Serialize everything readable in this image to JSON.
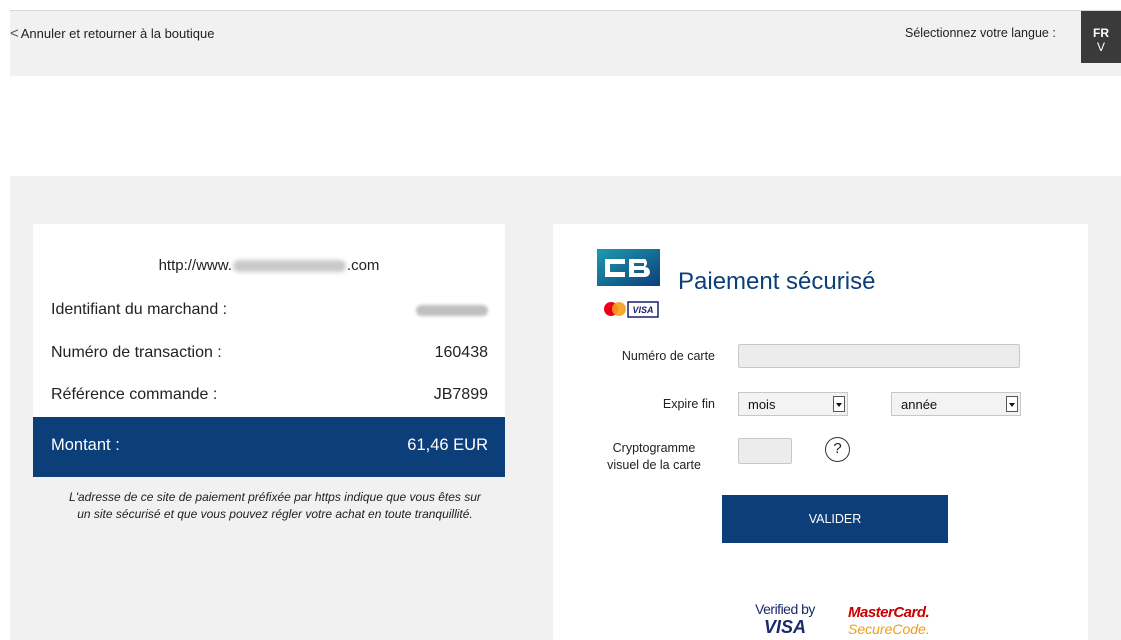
{
  "header": {
    "back_label": "Annuler et retourner à la boutique",
    "back_icon": "chevron-left-icon",
    "language_label": "Sélectionnez votre langue :",
    "language_code_line1": "FR",
    "language_code_line2": "V"
  },
  "order": {
    "url_prefix": "http://www.",
    "url_suffix": ".com",
    "merchant_id_label": "Identifiant du marchand :",
    "transaction_label": "Numéro de transaction :",
    "transaction_value": "160438",
    "reference_label": "Référence commande :",
    "reference_value": "JB7899",
    "amount_label": "Montant :",
    "amount_value": "61,46 EUR",
    "secure_note_line1": "L'adresse de ce site de paiement préfixée par https indique que vous êtes sur",
    "secure_note_line2": "un site sécurisé et que vous pouvez régler votre achat en toute tranquillité."
  },
  "payment": {
    "title": "Paiement sécurisé",
    "card_number_label": "Numéro de carte",
    "expiry_label": "Expire fin",
    "month_value": "mois",
    "year_value": "année",
    "cvv_label_line1": "Cryptogramme",
    "cvv_label_line2": "visuel de la carte",
    "help_symbol": "?",
    "submit_label": "VALIDER",
    "logo_visa": "VISA",
    "verified_line1": "Verified by",
    "verified_line2": "VISA",
    "mc_line1": "MasterCard.",
    "mc_line2": "SecureCode."
  },
  "colors": {
    "brand_blue": "#0c3f7a",
    "panel_gray": "#f1f1f1",
    "lang_bg": "#3a3a3a"
  }
}
